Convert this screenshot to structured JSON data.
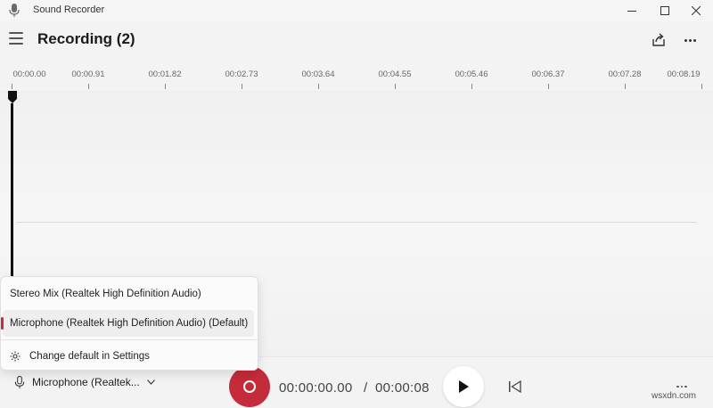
{
  "app": {
    "title": "Sound Recorder",
    "icon": "microphone-icon"
  },
  "header": {
    "title": "Recording (2)",
    "menu_icon": "hamburger-icon",
    "share_icon": "share-icon",
    "more_icon": "more-icon"
  },
  "timeline": {
    "ticks": [
      "00:00.00",
      "00:00.91",
      "00:01.82",
      "00:02.73",
      "00:03.64",
      "00:04.55",
      "00:05.46",
      "00:06.37",
      "00:07.28",
      "00:08.19"
    ]
  },
  "input_menu": {
    "options": [
      {
        "label": "Stereo Mix (Realtek High Definition Audio)",
        "selected": false
      },
      {
        "label": "Microphone (Realtek High Definition Audio) (Default)",
        "selected": true
      }
    ],
    "settings_label": "Change default in Settings"
  },
  "bottom": {
    "mic_label": "Microphone (Realtek...",
    "current_time": "00:00:00.00",
    "separator": "/",
    "total_time": "00:00:08"
  },
  "watermark": "wsxdn.com",
  "colors": {
    "accent": "#c42b3b",
    "background": "#f3f3f3"
  }
}
